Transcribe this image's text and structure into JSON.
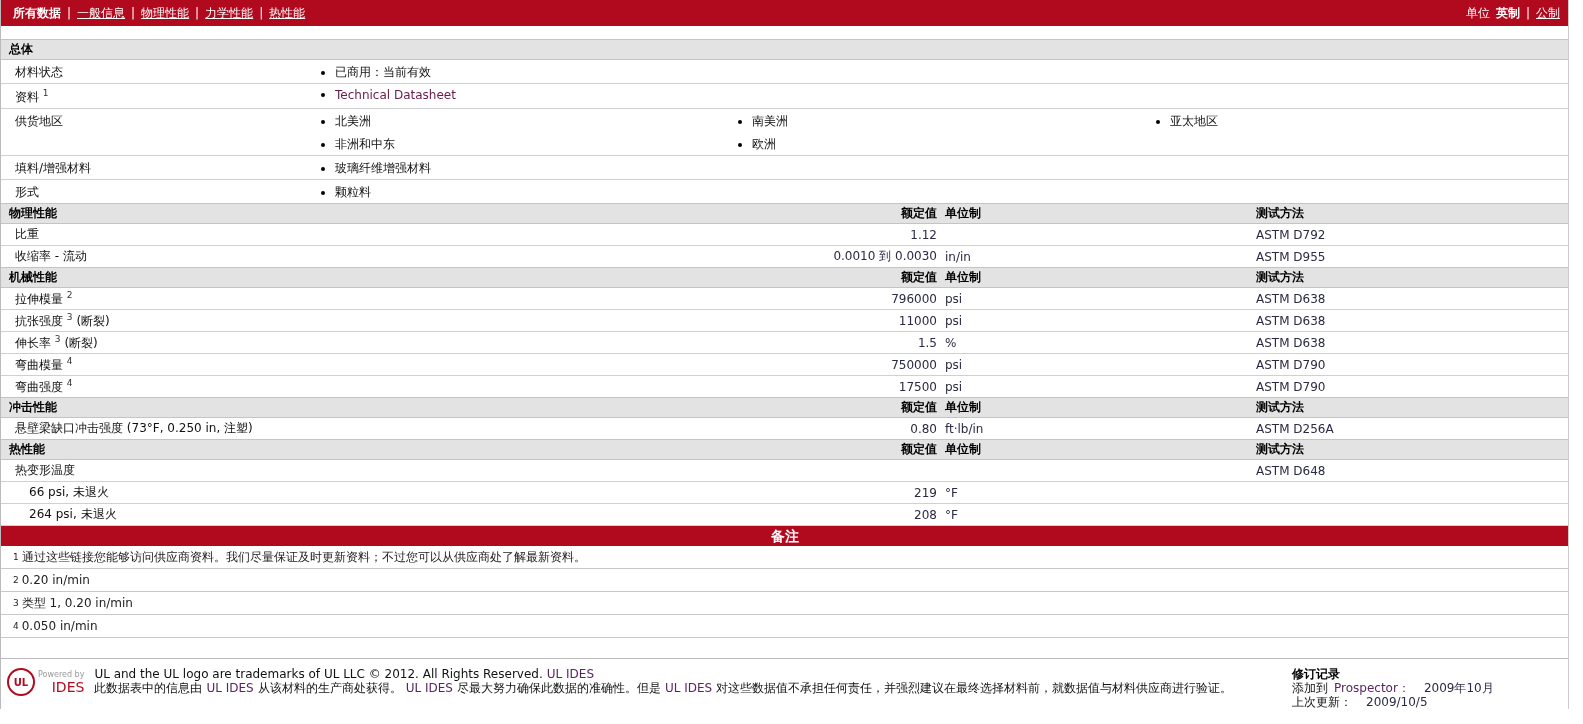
{
  "nav": {
    "separator": "|",
    "tabs": [
      {
        "label": "所有数据",
        "selected": true
      },
      {
        "label": "一般信息",
        "selected": false
      },
      {
        "label": "物理性能",
        "selected": false
      },
      {
        "label": "力学性能",
        "selected": false
      },
      {
        "label": "热性能",
        "selected": false
      }
    ],
    "units": {
      "label": "单位",
      "separator": "|",
      "options": [
        {
          "label": "英制",
          "selected": true
        },
        {
          "label": "公制",
          "selected": false
        }
      ]
    }
  },
  "general": {
    "title": "总体",
    "rows": [
      {
        "label": "材料状态",
        "values": [
          {
            "text": "已商用：当前有效",
            "kind": "text"
          }
        ]
      },
      {
        "label": "资料 $^{1}$",
        "values": [
          {
            "text": "Technical Datasheet",
            "kind": "link"
          }
        ]
      },
      {
        "label": "供货地区",
        "values": [
          {
            "text": "北美洲",
            "kind": "text"
          },
          {
            "text": "南美洲",
            "kind": "text"
          },
          {
            "text": "亚太地区",
            "kind": "text"
          },
          {
            "text": "非洲和中东",
            "kind": "text"
          },
          {
            "text": "欧洲",
            "kind": "text"
          }
        ]
      },
      {
        "label": "填料/增强材料",
        "values": [
          {
            "text": "玻璃纤维增强材料",
            "kind": "text"
          }
        ]
      },
      {
        "label": "形式",
        "values": [
          {
            "text": "颗粒料",
            "kind": "text"
          }
        ]
      }
    ]
  },
  "sections": [
    {
      "title": "物理性能",
      "headers": [
        "额定值",
        "单位制",
        "测试方法"
      ],
      "rows": [
        {
          "label": "比重",
          "value": "1.12",
          "method": "ASTM D792"
        },
        {
          "label": "收缩率  - 流动",
          "value": "0.0010 到  0.0030",
          "unit": "in/in",
          "method": "ASTM D955"
        }
      ]
    },
    {
      "title": "机械性能",
      "headers": [
        "额定值",
        "单位制",
        "测试方法"
      ],
      "rows": [
        {
          "label": "拉伸模量 $^{2}$",
          "value": "796000",
          "unit": "psi",
          "method": "ASTM D638"
        },
        {
          "label": "抗张强度 $^{3}$ (断裂)",
          "value": "11000",
          "unit": "psi",
          "method": "ASTM D638"
        },
        {
          "label": "伸长率 $^{3}$ (断裂)",
          "value": "1.5",
          "unit": "%",
          "method": "ASTM D638"
        },
        {
          "label": "弯曲模量 $^{4}$",
          "value": "750000",
          "unit": "psi",
          "method": "ASTM D790"
        },
        {
          "label": "弯曲强度 $^{4}$",
          "value": "17500",
          "unit": "psi",
          "method": "ASTM D790"
        }
      ]
    },
    {
      "title": "冲击性能",
      "headers": [
        "额定值",
        "单位制",
        "测试方法"
      ],
      "rows": [
        {
          "label": "悬壁梁缺口冲击强度  (73°F, 0.250 in, 注塑)",
          "value": "0.80",
          "unit": "ft·lb/in",
          "method": "ASTM D256A"
        }
      ]
    },
    {
      "title": "热性能",
      "headers": [
        "额定值",
        "单位制",
        "测试方法"
      ],
      "rows": [
        {
          "label": "热变形温度",
          "method": "ASTM D648",
          "children": [
            {
              "label": "66 psi, 未退火",
              "value": "219",
              "unit": "°F"
            },
            {
              "label": "264 psi, 未退火",
              "value": "208",
              "unit": "°F"
            }
          ]
        }
      ]
    }
  ],
  "notes": {
    "title": "备注",
    "items": [
      "$^{1}$通过这些链接您能够访问供应商资料。我们尽量保证及时更新资料；不过您可以从供应商处了解最新资料。",
      "$^{2}$0.20 in/min",
      "$^{3}$类型  1, 0.20 in/min",
      "$^{4}$0.050 in/min"
    ]
  },
  "footer": {
    "logo": {
      "mark": "UL",
      "small": "Powered by",
      "name": "IDES"
    },
    "lines": [
      [
        {
          "text": "UL and the UL logo are trademarks of UL LLC © 2012. All Rights Reserved.",
          "kind": "text"
        },
        {
          "text": "UL IDES",
          "kind": "link"
        }
      ],
      [
        {
          "text": "此数据表中的信息由",
          "kind": "text"
        },
        {
          "text": "UL IDES",
          "kind": "link"
        },
        {
          "text": "从该材料的生产商处获得。",
          "kind": "text"
        },
        {
          "text": "UL IDES",
          "kind": "link"
        },
        {
          "text": "尽最大努力确保此数据的准确性。但是",
          "kind": "text"
        },
        {
          "text": "UL IDES",
          "kind": "link"
        },
        {
          "text": "对这些数据值不承担任何责任，并强烈建议在最终选择材料前，就数据值与材料供应商进行验证。",
          "kind": "text"
        }
      ]
    ],
    "revision": {
      "title": "修订记录",
      "lines": [
        {
          "label": "添加到",
          "link": "Prospector：",
          "value": "2009年10月"
        },
        {
          "label": "上次更新：",
          "value": "2009/10/5"
        }
      ]
    }
  }
}
